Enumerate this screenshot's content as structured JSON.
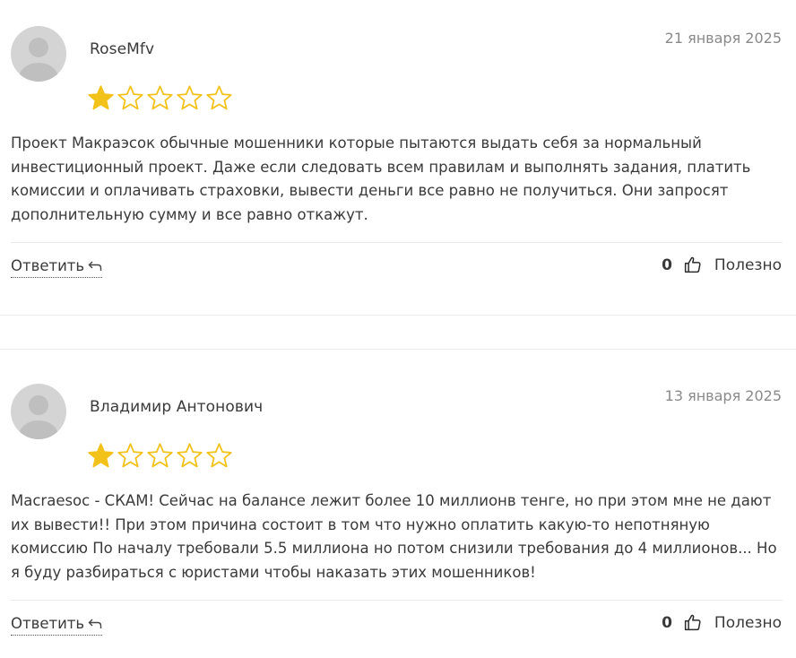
{
  "reviews": [
    {
      "author": "RoseMfv",
      "date": "21 января 2025",
      "rating": 1,
      "max_rating": 5,
      "text": "Проект Макраэсок обычные мошенники которые пытаются выдать себя за нормальный инвестиционный проект. Даже если следовать всем правилам и выполнять задания, платить комиссии и оплачивать страховки, вывести деньги все равно не получиться. Они запросят дополнительную сумму и все равно откажут.",
      "reply_label": "Ответить",
      "helpful_count": "0",
      "helpful_label": "Полезно"
    },
    {
      "author": "Владимир Антонович",
      "date": "13 января 2025",
      "rating": 1,
      "max_rating": 5,
      "text": "Macraesoc - СКАМ! Сейчас на балансе лежит более 10 миллионв тенге, но при этом мне не дают их вывести!! При этом причина состоит в том что нужно оплатить какую-то непотняную комиссию По началу требовали 5.5 миллиона но потом снизили требования до 4 миллионов... Но я буду разбираться с юристами чтобы наказать этих мошенников!",
      "reply_label": "Ответить",
      "helpful_count": "0",
      "helpful_label": "Полезно"
    }
  ],
  "colors": {
    "star_filled": "#f2c21b",
    "star_outline": "#f2c21b",
    "avatar_bg": "#d4d4d4",
    "avatar_fg": "#bfbfbf"
  }
}
